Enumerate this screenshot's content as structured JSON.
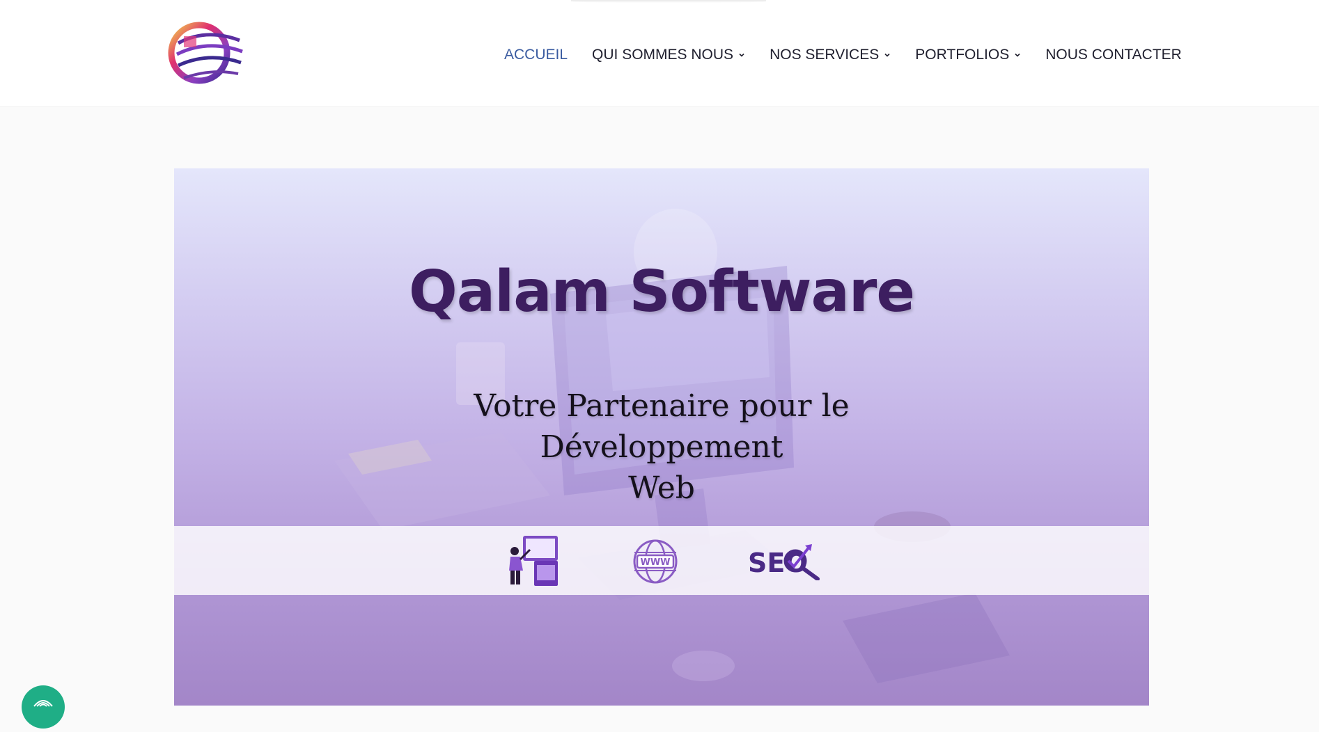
{
  "brand": {
    "logo_icon": "globe-swoosh-logo"
  },
  "nav": {
    "items": [
      {
        "label": "ACCUEIL",
        "active": true,
        "dropdown": false
      },
      {
        "label": "QUI SOMMES NOUS",
        "active": false,
        "dropdown": true
      },
      {
        "label": "NOS SERVICES",
        "active": false,
        "dropdown": true
      },
      {
        "label": "PORTFOLIOS",
        "active": false,
        "dropdown": true
      },
      {
        "label": "NOUS CONTACTER",
        "active": false,
        "dropdown": false
      }
    ]
  },
  "hero": {
    "title": "Qalam Software",
    "subtitle_line1": "Votre Partenaire pour le Développement",
    "subtitle_line2": "Web",
    "services": [
      {
        "icon": "web-design-icon"
      },
      {
        "icon": "www-globe-icon"
      },
      {
        "icon": "seo-icon",
        "text": "SEO"
      }
    ]
  },
  "colors": {
    "accent": "#3a5ba0",
    "title": "#3d1e60",
    "hero_bottom": "#a386c8",
    "fab": "#1fae86"
  }
}
